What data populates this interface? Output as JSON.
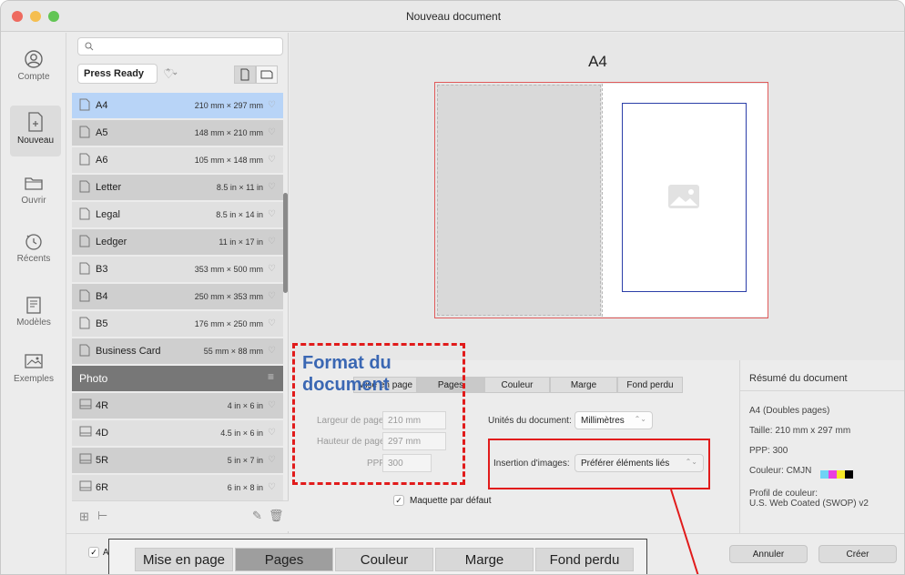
{
  "window": {
    "title": "Nouveau document"
  },
  "nav": [
    {
      "label": "Compte",
      "icon": "user-icon"
    },
    {
      "label": "Nouveau",
      "icon": "new-document-icon",
      "selected": true
    },
    {
      "label": "Ouvrir",
      "icon": "folder-icon"
    },
    {
      "label": "Récents",
      "icon": "recent-icon"
    },
    {
      "label": "Modèles",
      "icon": "templates-icon"
    },
    {
      "label": "Exemples",
      "icon": "samples-icon"
    }
  ],
  "presets": {
    "category": "Press Ready",
    "items": [
      {
        "name": "A4",
        "size": "210 mm × 297 mm",
        "selected": true
      },
      {
        "name": "A5",
        "size": "148 mm × 210 mm"
      },
      {
        "name": "A6",
        "size": "105 mm × 148 mm"
      },
      {
        "name": "Letter",
        "size": "8.5 in × 11 in"
      },
      {
        "name": "Legal",
        "size": "8.5 in × 14 in"
      },
      {
        "name": "Ledger",
        "size": "11 in × 17 in"
      },
      {
        "name": "B3",
        "size": "353 mm × 500 mm"
      },
      {
        "name": "B4",
        "size": "250 mm × 353 mm"
      },
      {
        "name": "B5",
        "size": "176 mm × 250 mm"
      },
      {
        "name": "Business Card",
        "size": "55 mm × 88 mm"
      }
    ],
    "section": "Photo",
    "photo_items": [
      {
        "name": "4R",
        "size": "4 in × 6 in"
      },
      {
        "name": "4D",
        "size": "4.5 in × 6 in"
      },
      {
        "name": "5R",
        "size": "5 in × 7 in"
      },
      {
        "name": "6R",
        "size": "6 in × 8 in"
      }
    ]
  },
  "preview": {
    "title": "A4"
  },
  "settings": {
    "tabs": [
      "Mise en page",
      "Pages",
      "Couleur",
      "Marge",
      "Fond perdu"
    ],
    "page_width_label": "Largeur de page:",
    "page_width_value": "210 mm",
    "page_height_label": "Hauteur de page:",
    "page_height_value": "297 mm",
    "ppp_label": "PPP:",
    "ppp_value": "300",
    "units_label": "Unités du document:",
    "units_value": "Millimètres",
    "image_insertion_label": "Insertion d'images:",
    "image_insertion_value": "Préférer éléments liés",
    "default_master_label": "Maquette par défaut",
    "default_master_checked": true
  },
  "summary": {
    "title": "Résumé du document",
    "line1": "A4 (Doubles pages)",
    "line2": "Taille: 210 mm x 297 mm",
    "line3": "PPP:  300",
    "line4": "Couleur: CMJN",
    "line5": "Profil de couleur:",
    "line6": "U.S. Web Coated (SWOP) v2",
    "swatches": [
      "#6fd3f5",
      "#ea3fe0",
      "#f4e82a",
      "#000000"
    ]
  },
  "footer": {
    "checkbox_label": "A",
    "cancel": "Annuler",
    "create": "Créer"
  },
  "annotation": {
    "title": "Format du document"
  },
  "zoom_tabs": [
    "Mise en page",
    "Pages",
    "Couleur",
    "Marge",
    "Fond perdu"
  ]
}
